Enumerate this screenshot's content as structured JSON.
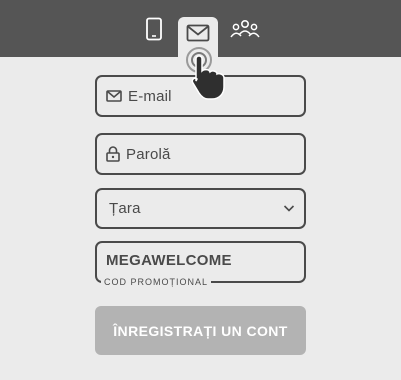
{
  "tabs": [
    {
      "name": "phone",
      "icon": "phone-icon"
    },
    {
      "name": "email",
      "icon": "mail-icon",
      "active": true
    },
    {
      "name": "group",
      "icon": "group-icon"
    }
  ],
  "form": {
    "email": {
      "placeholder": "E-mail",
      "icon": "mail-icon"
    },
    "password": {
      "placeholder": "Parolă",
      "icon": "lock-icon"
    },
    "country": {
      "placeholder": "Țara",
      "icon": "chevron-down-icon"
    },
    "promo": {
      "value": "MEGAWELCOME",
      "caption": "COD PROMOȚIONAL"
    },
    "submit_label": "ÎNREGISTRAȚI UN CONT"
  },
  "colors": {
    "topbar": "#555555",
    "background": "#ebebeb",
    "border": "#4a4a4a",
    "button_disabled": "#b3b3b3",
    "button_text": "#ffffff"
  }
}
